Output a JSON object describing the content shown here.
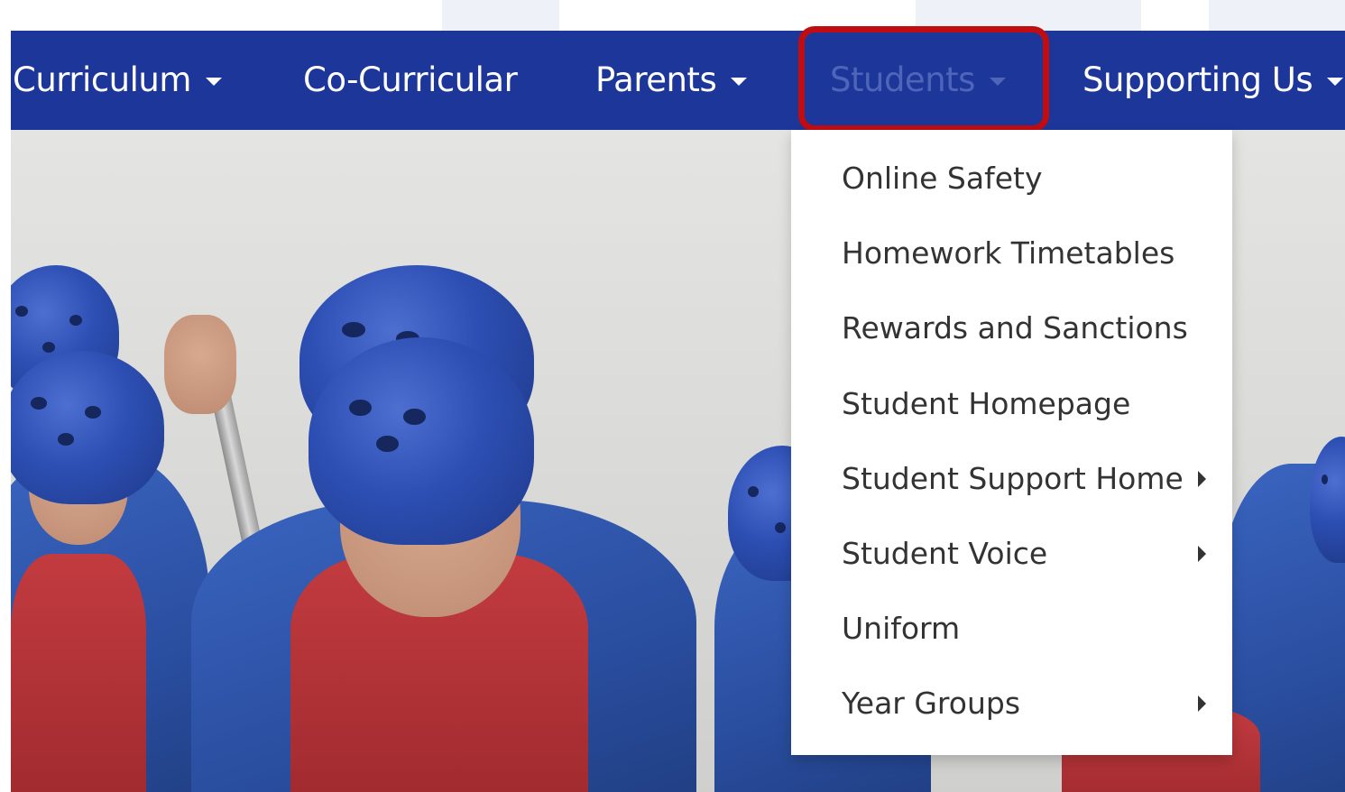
{
  "nav": {
    "items": [
      {
        "label": "Curriculum",
        "has_caret": true
      },
      {
        "label": "Co-Curricular",
        "has_caret": false
      },
      {
        "label": "Parents",
        "has_caret": true
      },
      {
        "label": "Students",
        "has_caret": true,
        "active": true
      },
      {
        "label": "Supporting Us",
        "has_caret": true
      }
    ]
  },
  "dropdown": {
    "items": [
      {
        "label": "Online Safety",
        "submenu": false
      },
      {
        "label": "Homework Timetables",
        "submenu": false
      },
      {
        "label": "Rewards and Sanctions",
        "submenu": false
      },
      {
        "label": "Student Homepage",
        "submenu": false
      },
      {
        "label": "Student Support Home",
        "submenu": true
      },
      {
        "label": "Student Voice",
        "submenu": true
      },
      {
        "label": "Uniform",
        "submenu": false
      },
      {
        "label": "Year Groups",
        "submenu": true
      }
    ]
  },
  "colors": {
    "navbar_bg": "#1d369a",
    "nav_text": "#ffffff",
    "nav_active_text": "#4f66b8",
    "highlight_border": "#c00d12",
    "dropdown_text": "#333333"
  },
  "icons": {
    "caret": "caret-down-icon",
    "submenu_arrow": "caret-right-icon"
  }
}
